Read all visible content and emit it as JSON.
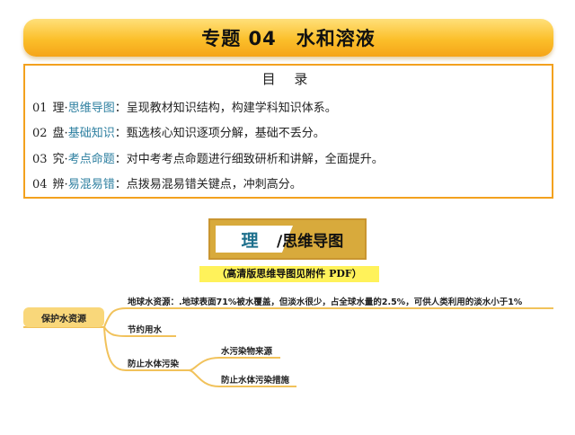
{
  "title": "专题 04　水和溶液",
  "toc": {
    "heading": "目 录",
    "items": [
      {
        "num": "01",
        "prefix": "理·",
        "link": "思维导图",
        "desc": "：呈现教材知识结构，构建学科知识体系。"
      },
      {
        "num": "02",
        "prefix": "盘·",
        "link": "基础知识",
        "desc": "：甄选核心知识逐项分解，基础不丢分。"
      },
      {
        "num": "03",
        "prefix": "究·",
        "link": "考点命题",
        "desc": "：对中考考点命题进行细致研析和讲解，全面提升。"
      },
      {
        "num": "04",
        "prefix": "辨·",
        "link": "易混易错",
        "desc": "：点拨易混易错关键点，冲刺高分。"
      }
    ]
  },
  "banner": {
    "left": "理",
    "right": "/思维导图"
  },
  "subnote": "（高清版思维导图见附件 PDF）",
  "mindmap": {
    "root": "保护水资源",
    "branches": [
      {
        "label": "地球水资源：.地球表面71%被水覆盖，但淡水很少，占全球水量的2.5%，可供人类利用的淡水小于1%"
      },
      {
        "label": "节约用水"
      },
      {
        "label": "防止水体污染",
        "children": [
          "水污染物来源",
          "防止水体污染措施"
        ]
      }
    ]
  },
  "colors": {
    "accent": "#f3a11e",
    "line": "#f1c25b",
    "link": "#2d7fa0"
  }
}
